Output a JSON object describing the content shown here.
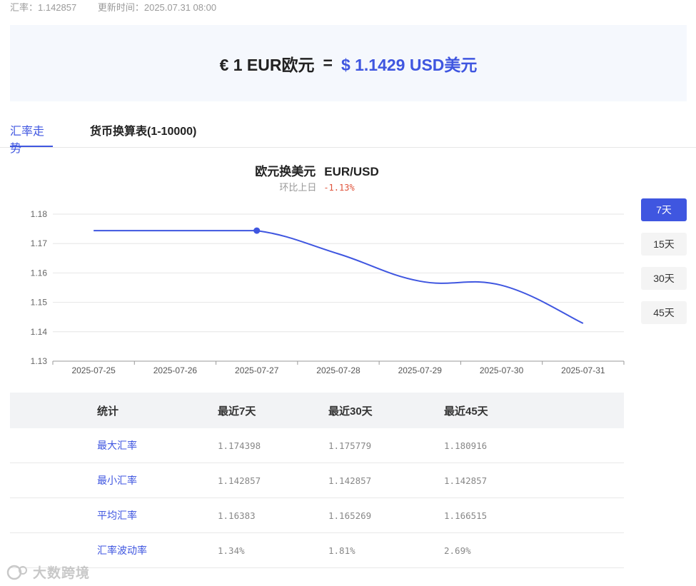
{
  "header": {
    "rate_text": "汇率：1.142857",
    "updated_text": "更新时间：2025.07.31 08:00"
  },
  "banner": {
    "lhs": "€ 1  EUR欧元",
    "eq": "=",
    "rhs": "$ 1.1429  USD美元"
  },
  "tabs": [
    {
      "label": "汇率走势",
      "active": true
    },
    {
      "label": "货币换算表(1-10000)",
      "active": false
    }
  ],
  "ranges": [
    {
      "label": "7天",
      "active": true
    },
    {
      "label": "15天",
      "active": false
    },
    {
      "label": "30天",
      "active": false
    },
    {
      "label": "45天",
      "active": false
    }
  ],
  "chart_data": {
    "type": "line",
    "title": "欧元换美元",
    "pair": "EUR/USD",
    "change_label": "环比上日",
    "change_value": "-1.13%",
    "x": [
      "2025-07-25",
      "2025-07-26",
      "2025-07-27",
      "2025-07-28",
      "2025-07-29",
      "2025-07-30",
      "2025-07-31"
    ],
    "series": [
      {
        "values": [
          1.174398,
          1.174398,
          1.174398,
          1.1665,
          1.1572,
          1.1558,
          1.142857
        ]
      }
    ],
    "ylim": [
      1.13,
      1.18
    ],
    "yticks": [
      "1.13",
      "1.14",
      "1.15",
      "1.16",
      "1.17",
      "1.18"
    ],
    "highlight_index": 2,
    "grid": true,
    "line_color": "#3f56e0"
  },
  "stats": {
    "headers": [
      "统计",
      "最近7天",
      "最近30天",
      "最近45天"
    ],
    "rows": [
      [
        "最大汇率",
        "1.174398",
        "1.175779",
        "1.180916"
      ],
      [
        "最小汇率",
        "1.142857",
        "1.142857",
        "1.142857"
      ],
      [
        "平均汇率",
        "1.16383",
        "1.165269",
        "1.166515"
      ],
      [
        "汇率波动率",
        "1.34%",
        "1.81%",
        "2.69%"
      ]
    ]
  },
  "watermark": "大数跨境"
}
